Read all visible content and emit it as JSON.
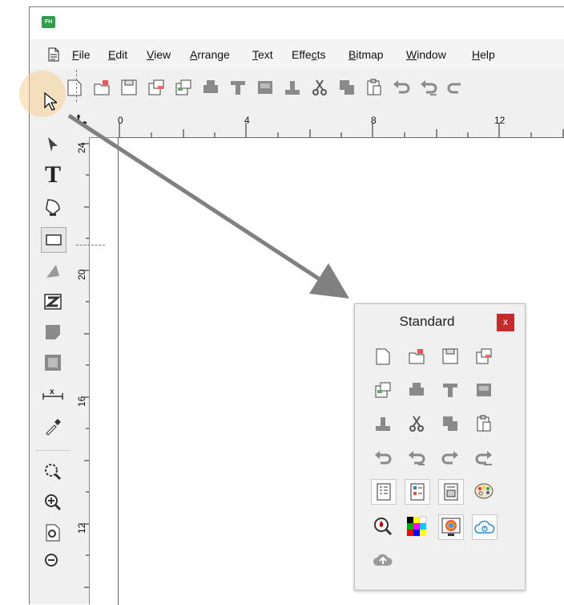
{
  "app": {
    "icon_text": "FH"
  },
  "menu": {
    "items": [
      {
        "label": "File",
        "key": "F"
      },
      {
        "label": "Edit",
        "key": "E"
      },
      {
        "label": "View",
        "key": "V"
      },
      {
        "label": "Arrange",
        "key": "A"
      },
      {
        "label": "Text",
        "key": "T"
      },
      {
        "label": "Effects",
        "key": "c"
      },
      {
        "label": "Bitmap",
        "key": "B"
      },
      {
        "label": "Window",
        "key": "W"
      },
      {
        "label": "Help",
        "key": "H"
      }
    ]
  },
  "ruler": {
    "horizontal": [
      "0",
      "4",
      "8",
      "12"
    ],
    "vertical": [
      "24",
      "20",
      "16",
      "12"
    ]
  },
  "panel": {
    "title": "Standard",
    "close_label": "x"
  },
  "colors": {
    "accent_green": "#2e9e4b",
    "close_red": "#c42b2b",
    "arrow_gray": "#808080",
    "toolbar_gray": "#f0f0f0"
  }
}
